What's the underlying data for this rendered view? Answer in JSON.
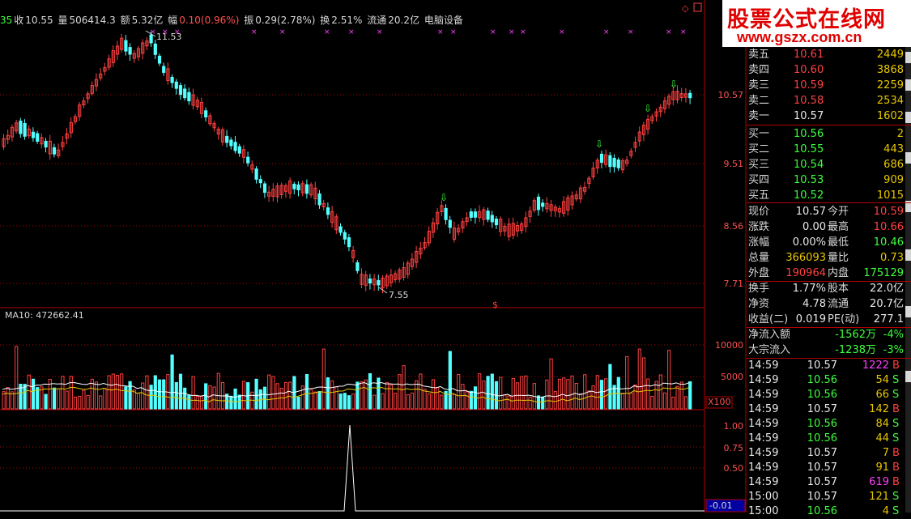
{
  "header": {
    "prefix": "35",
    "close_label": "收",
    "close_value": "10.55",
    "volume_label": "量",
    "volume_value": "506414.3",
    "amount_label": "额",
    "amount_value": "5.32亿",
    "change_label": "幅",
    "change_value": "0.10(0.96%)",
    "amplitude_label": "振",
    "amplitude_value": "0.29(2.78%)",
    "turnover_label": "换",
    "turnover_value": "2.51%",
    "float_label": "流通",
    "float_value": "20.2亿",
    "industry": "电脑设备"
  },
  "watermark": {
    "line1": "股票公式在线网",
    "line2": "www.gszx.com.cn"
  },
  "price_axis": [
    "10.57",
    "9.51",
    "8.56",
    "7.71"
  ],
  "annotations": {
    "high": "11.53",
    "low": "7.55"
  },
  "volume_indicator": {
    "label": "MA10: 472662.41",
    "axis": [
      "10000",
      "5000"
    ],
    "multiplier": "X100"
  },
  "osc_axis": [
    "1.00",
    "0.75",
    "0.50",
    "-0.01"
  ],
  "orderbook": {
    "asks": [
      {
        "label": "卖五",
        "price": "10.61",
        "vol": "2449"
      },
      {
        "label": "卖四",
        "price": "10.60",
        "vol": "3868"
      },
      {
        "label": "卖三",
        "price": "10.59",
        "vol": "2259"
      },
      {
        "label": "卖二",
        "price": "10.58",
        "vol": "2534"
      },
      {
        "label": "卖一",
        "price": "10.57",
        "vol": "1602"
      }
    ],
    "bids": [
      {
        "label": "买一",
        "price": "10.56",
        "vol": "2"
      },
      {
        "label": "买二",
        "price": "10.55",
        "vol": "443"
      },
      {
        "label": "买三",
        "price": "10.54",
        "vol": "686"
      },
      {
        "label": "买四",
        "price": "10.53",
        "vol": "909"
      },
      {
        "label": "买五",
        "price": "10.52",
        "vol": "1015"
      }
    ]
  },
  "quote": [
    {
      "l1": "现价",
      "v1": "10.57",
      "l2": "今开",
      "v2": "10.59"
    },
    {
      "l1": "涨跌",
      "v1": "0.00",
      "l2": "最高",
      "v2": "10.66"
    },
    {
      "l1": "涨幅",
      "v1": "0.00%",
      "l2": "最低",
      "v2": "10.46"
    },
    {
      "l1": "总量",
      "v1": "366093",
      "l2": "量比",
      "v2": "0.73"
    },
    {
      "l1": "外盘",
      "v1": "190964",
      "l2": "内盘",
      "v2": "175129"
    }
  ],
  "fundamentals": [
    {
      "l1": "换手",
      "v1": "1.77%",
      "l2": "股本",
      "v2": "22.0亿"
    },
    {
      "l1": "净资",
      "v1": "4.78",
      "l2": "流通",
      "v2": "20.7亿"
    },
    {
      "l1": "收益(二)",
      "v1": "0.019",
      "l2": "PE(动)",
      "v2": "277.1"
    }
  ],
  "flows": [
    {
      "label": "净流入额",
      "value": "-1562万",
      "pct": "-4%"
    },
    {
      "label": "大宗流入",
      "value": "-1238万",
      "pct": "-3%"
    }
  ],
  "ticks": [
    {
      "time": "14:59",
      "price": "10.57",
      "vol": "1222",
      "side": "B"
    },
    {
      "time": "14:59",
      "price": "10.56",
      "vol": "54",
      "side": "S"
    },
    {
      "time": "14:59",
      "price": "10.56",
      "vol": "66",
      "side": "S"
    },
    {
      "time": "14:59",
      "price": "10.57",
      "vol": "142",
      "side": "B"
    },
    {
      "time": "14:59",
      "price": "10.56",
      "vol": "84",
      "side": "S"
    },
    {
      "time": "14:59",
      "price": "10.56",
      "vol": "44",
      "side": "S"
    },
    {
      "time": "14:59",
      "price": "10.57",
      "vol": "7",
      "side": "B"
    },
    {
      "time": "14:59",
      "price": "10.57",
      "vol": "91",
      "side": "B"
    },
    {
      "time": "14:59",
      "price": "10.57",
      "vol": "619",
      "side": "B"
    },
    {
      "time": "15:00",
      "price": "10.57",
      "vol": "121",
      "side": "S"
    },
    {
      "time": "15:00",
      "price": "10.56",
      "vol": "4",
      "side": "S"
    }
  ],
  "colors": {
    "up": "#ff4040",
    "down": "#54ffff",
    "grid": "#b00000",
    "ma": "#ffffff"
  }
}
